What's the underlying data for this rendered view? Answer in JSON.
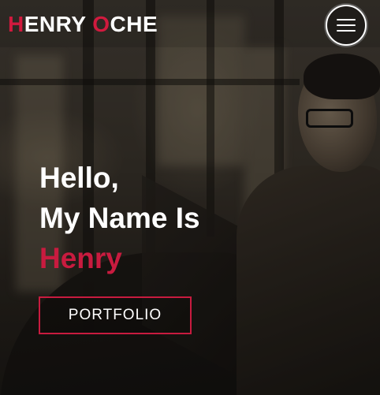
{
  "header": {
    "logo": {
      "first_initial": "H",
      "first_rest": "ENRY ",
      "last_initial": "O",
      "last_rest": "CHE"
    },
    "menu_button_icon": "hamburger-menu-icon"
  },
  "hero": {
    "line1": "Hello,",
    "line2": "My Name Is",
    "line3": "Henry",
    "cta_label": "PORTFOLIO"
  },
  "colors": {
    "accent": "#c81b3f",
    "text": "#ffffff"
  }
}
